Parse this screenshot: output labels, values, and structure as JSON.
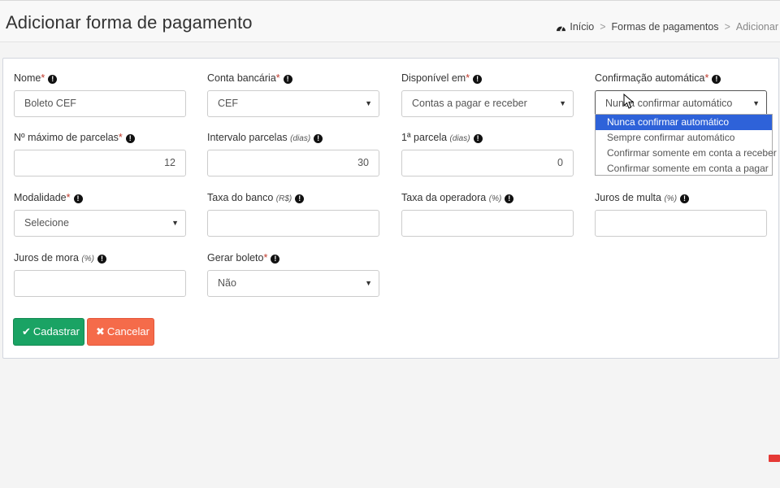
{
  "header": {
    "title": "Adicionar forma de pagamento",
    "breadcrumb": {
      "home": "Início",
      "section": "Formas de pagamentos",
      "current": "Adicionar"
    }
  },
  "form": {
    "nome": {
      "label": "Nome",
      "value": "Boleto CEF"
    },
    "conta_bancaria": {
      "label": "Conta bancária",
      "value": "CEF"
    },
    "disponivel_em": {
      "label": "Disponível em",
      "value": "Contas a pagar e receber"
    },
    "confirmacao_automatica": {
      "label": "Confirmação automática",
      "value": "Nunca confirmar automático",
      "options": [
        "Nunca confirmar automático",
        "Sempre confirmar automático",
        "Confirmar somente em conta a receber",
        "Confirmar somente em conta a pagar"
      ]
    },
    "max_parcelas": {
      "label": "Nº máximo de parcelas",
      "value": "12"
    },
    "intervalo_parcelas": {
      "label": "Intervalo parcelas",
      "unit": "(dias)",
      "value": "30"
    },
    "primeira_parcela": {
      "label": "1ª parcela",
      "unit": "(dias)",
      "value": "0"
    },
    "modalidade": {
      "label": "Modalidade",
      "value": "Selecione"
    },
    "taxa_banco": {
      "label": "Taxa do banco",
      "unit": "(R$)",
      "value": ""
    },
    "taxa_operadora": {
      "label": "Taxa da operadora",
      "unit": "(%)",
      "value": ""
    },
    "juros_multa": {
      "label": "Juros de multa",
      "unit": "(%)",
      "value": ""
    },
    "juros_mora": {
      "label": "Juros de mora",
      "unit": "(%)",
      "value": ""
    },
    "gerar_boleto": {
      "label": "Gerar boleto",
      "value": "Não"
    },
    "required_mark": "*"
  },
  "buttons": {
    "save": "Cadastrar",
    "cancel": "Cancelar"
  },
  "colors": {
    "save": "#1aa364",
    "cancel": "#f56b4a",
    "dropdown_selected": "#2e62d9"
  }
}
